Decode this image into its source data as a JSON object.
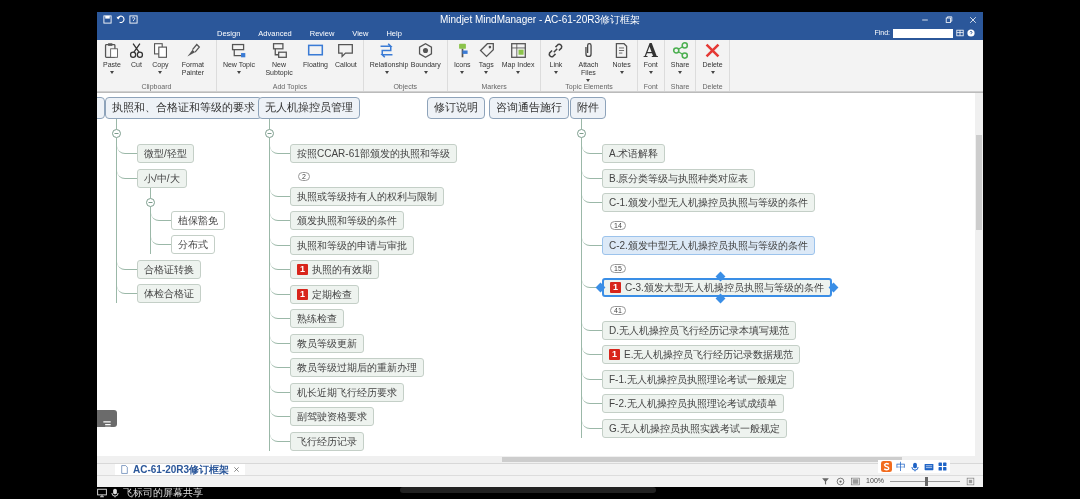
{
  "window": {
    "title": "Mindjet MindManager - AC-61-20R3修订框架"
  },
  "ribbon_tabs": [
    {
      "label": "Design",
      "selected": false
    },
    {
      "label": "Advanced",
      "selected": false
    },
    {
      "label": "Review",
      "selected": false
    },
    {
      "label": "View",
      "selected": false
    },
    {
      "label": "Help",
      "selected": false
    }
  ],
  "find": {
    "label": "Find:"
  },
  "ribbon_groups": [
    {
      "label": "Clipboard",
      "buttons": [
        {
          "label": "Paste",
          "has_menu": true
        },
        {
          "label": "Cut",
          "has_menu": false
        },
        {
          "label": "Copy",
          "has_menu": true
        },
        {
          "label": "Format Painter",
          "has_menu": false
        }
      ]
    },
    {
      "label": "Add Topics",
      "buttons": [
        {
          "label": "New Topic",
          "has_menu": true
        },
        {
          "label": "New Subtopic",
          "has_menu": false
        },
        {
          "label": "Floating",
          "has_menu": false
        },
        {
          "label": "Callout",
          "has_menu": false
        }
      ]
    },
    {
      "label": "Objects",
      "buttons": [
        {
          "label": "Relationship",
          "has_menu": true
        },
        {
          "label": "Boundary",
          "has_menu": true
        }
      ]
    },
    {
      "label": "Markers",
      "buttons": [
        {
          "label": "Icons",
          "has_menu": true
        },
        {
          "label": "Tags",
          "has_menu": true
        },
        {
          "label": "Map Index",
          "has_menu": true
        }
      ]
    },
    {
      "label": "Topic Elements",
      "buttons": [
        {
          "label": "Link",
          "has_menu": true
        },
        {
          "label": "Attach Files",
          "has_menu": true
        },
        {
          "label": "Notes",
          "has_menu": true
        }
      ]
    },
    {
      "label": "Font",
      "buttons": [
        {
          "label": "Font",
          "has_menu": true,
          "glyph": "A"
        }
      ]
    },
    {
      "label": "Share",
      "buttons": [
        {
          "label": "Share",
          "has_menu": true
        }
      ]
    },
    {
      "label": "Delete",
      "buttons": [
        {
          "label": "Delete",
          "has_menu": true
        }
      ]
    }
  ],
  "map": {
    "main_topics": [
      {
        "text": "执照和、合格证和等级的要求",
        "children": [
          {
            "text": "微型/轻型",
            "selected": false
          },
          {
            "text": "小/中/大",
            "selected": false,
            "children": [
              {
                "text": "植保豁免",
                "selected": false
              },
              {
                "text": "分布式",
                "selected": false
              }
            ]
          },
          {
            "text": "合格证转换",
            "selected": false
          },
          {
            "text": "体检合格证",
            "selected": false
          }
        ]
      },
      {
        "text": "无人机操控员管理",
        "children": [
          {
            "text": "按照CCAR-61部颁发的执照和等级",
            "selected": false,
            "collapsed_count": "2"
          },
          {
            "text": "执照或等级持有人的权利与限制",
            "selected": false
          },
          {
            "text": "颁发执照和等级的条件",
            "selected": false
          },
          {
            "text": "执照和等级的申请与审批",
            "selected": false
          },
          {
            "text": "执照的有效期",
            "selected": false,
            "priority": "1"
          },
          {
            "text": "定期检查",
            "selected": false,
            "priority": "1"
          },
          {
            "text": "熟练检查",
            "selected": false
          },
          {
            "text": "教员等级更新",
            "selected": false
          },
          {
            "text": "教员等级过期后的重新办理",
            "selected": false
          },
          {
            "text": "机长近期飞行经历要求",
            "selected": false
          },
          {
            "text": "副驾驶资格要求",
            "selected": false
          },
          {
            "text": "飞行经历记录",
            "selected": false
          }
        ]
      },
      {
        "text": "修订说明"
      },
      {
        "text": "咨询通告施行"
      },
      {
        "text": "附件",
        "children": [
          {
            "text": "A.术语解释",
            "selected": false,
            "hovered": false
          },
          {
            "text": "B.原分类等级与执照种类对应表",
            "selected": false,
            "hovered": false
          },
          {
            "text": "C-1.颁发小型无人机操控员执照与等级的条件",
            "selected": false,
            "hovered": false,
            "collapsed_count": "14"
          },
          {
            "text": "C-2.颁发中型无人机操控员执照与等级的条件",
            "selected": false,
            "hovered": true,
            "collapsed_count": "15"
          },
          {
            "text": "C-3.颁发大型无人机操控员执照与等级的条件",
            "selected": true,
            "hovered": false,
            "priority": "1",
            "collapsed_count": "41"
          },
          {
            "text": "D.无人机操控员飞行经历记录本填写规范",
            "selected": false,
            "hovered": false
          },
          {
            "text": "E.无人机操控员飞行经历记录数据规范",
            "selected": false,
            "hovered": false,
            "priority": "1"
          },
          {
            "text": "F-1.无人机操控员执照理论考试一般规定",
            "selected": false,
            "hovered": false
          },
          {
            "text": "F-2.无人机操控员执照理论考试成绩单",
            "selected": false,
            "hovered": false
          },
          {
            "text": "G.无人机操控员执照实践考试一般规定",
            "selected": false,
            "hovered": false
          }
        ]
      }
    ]
  },
  "document_tabs": [
    {
      "label": "AC-61-20R3修订框架",
      "selected": true
    }
  ],
  "status_bar": {
    "zoom": {
      "reading": "100%",
      "level": 0.5
    }
  },
  "ime": {
    "mode": "中"
  },
  "screen_share": {
    "text": "飞标司的屏幕共享"
  }
}
